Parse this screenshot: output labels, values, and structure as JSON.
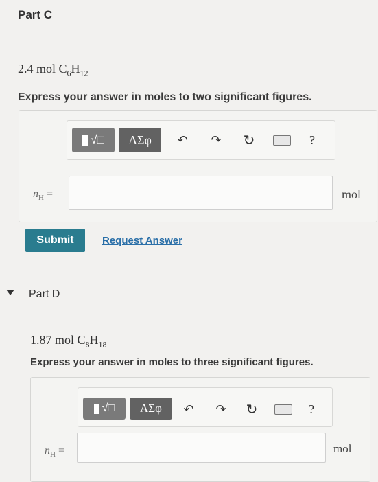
{
  "partC": {
    "title": "Part C",
    "problem_amount": "2.4 mol",
    "formula_c": "C",
    "formula_c_sub": "6",
    "formula_h": "H",
    "formula_h_sub": "12",
    "instruction": "Express your answer in moles to two significant figures.",
    "toolbar": {
      "template_label": "√□",
      "greek_label": "ΑΣφ",
      "help_label": "?"
    },
    "var_label": "n",
    "var_sub": "H",
    "equals": "=",
    "input_value": "",
    "unit": "mol",
    "submit_label": "Submit",
    "request_label": "Request Answer"
  },
  "partD": {
    "title": "Part D",
    "problem_amount": "1.87 mol",
    "formula_c": "C",
    "formula_c_sub": "8",
    "formula_h": "H",
    "formula_h_sub": "18",
    "instruction": "Express your answer in moles to three significant figures.",
    "toolbar": {
      "template_label": "√□",
      "greek_label": "ΑΣφ",
      "help_label": "?"
    },
    "var_label": "n",
    "var_sub": "H",
    "equals": "=",
    "input_value": "",
    "unit": "mol"
  },
  "icons": [
    "undo-icon",
    "redo-icon",
    "reset-icon",
    "keyboard-icon",
    "collapse-triangle-icon"
  ]
}
